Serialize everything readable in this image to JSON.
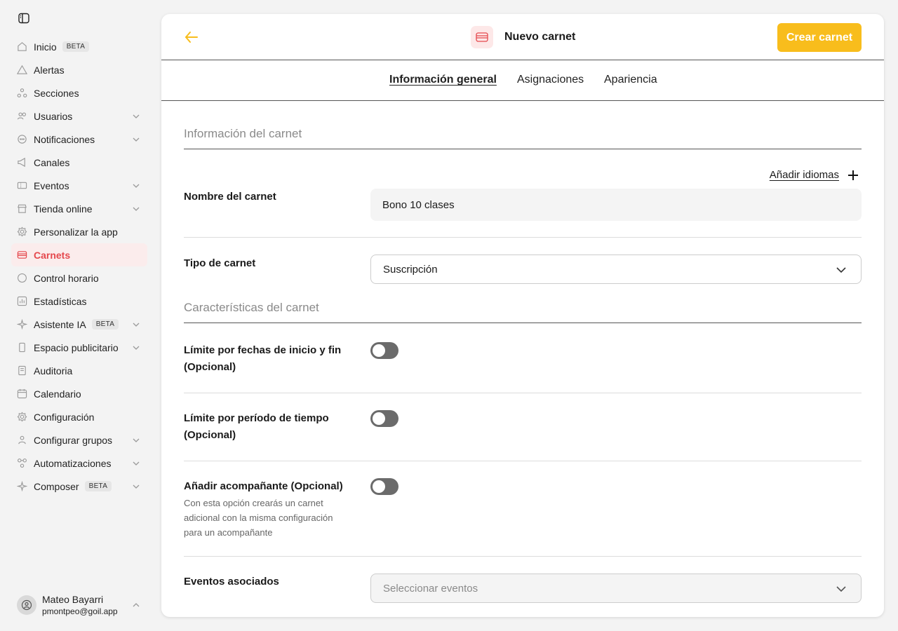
{
  "sidebar": {
    "items": [
      {
        "label": "Inicio",
        "beta": "BETA",
        "icon": "home-icon"
      },
      {
        "label": "Alertas",
        "icon": "alert-icon"
      },
      {
        "label": "Secciones",
        "icon": "sections-icon"
      },
      {
        "label": "Usuarios",
        "icon": "users-icon"
      },
      {
        "label": "Notificaciones",
        "icon": "chat-icon"
      },
      {
        "label": "Canales",
        "icon": "megaphone-icon"
      },
      {
        "label": "Eventos",
        "icon": "ticket-icon"
      },
      {
        "label": "Tienda online",
        "icon": "shop-icon"
      },
      {
        "label": "Personalizar la app",
        "icon": "gear-icon"
      },
      {
        "label": "Carnets",
        "icon": "card-icon"
      },
      {
        "label": "Control horario",
        "icon": "clock-icon"
      },
      {
        "label": "Estadísticas",
        "icon": "chart-icon"
      },
      {
        "label": "Asistente IA",
        "beta": "BETA",
        "icon": "sparkle-icon"
      },
      {
        "label": "Espacio publicitario",
        "icon": "phone-icon"
      },
      {
        "label": "Auditoria",
        "icon": "document-icon"
      },
      {
        "label": "Calendario",
        "icon": "calendar-icon"
      },
      {
        "label": "Configuración",
        "icon": "gear-icon"
      },
      {
        "label": "Configurar grupos",
        "icon": "group-icon"
      },
      {
        "label": "Automatizaciones",
        "icon": "automation-icon"
      },
      {
        "label": "Composer",
        "beta": "BETA",
        "icon": "sparkle-icon"
      }
    ],
    "active_color": "#e5484d"
  },
  "user": {
    "name": "Mateo Bayarri",
    "email": "pmontpeo@goil.app"
  },
  "header": {
    "title": "Nuevo carnet",
    "create_label": "Crear carnet",
    "accent": "#f8bd1c"
  },
  "tabs": [
    "Información general",
    "Asignaciones",
    "Apariencia"
  ],
  "form": {
    "section1": "Información del carnet",
    "add_languages": "Añadir idiomas",
    "name_label": "Nombre del carnet",
    "name_value": "Bono 10 clases",
    "type_label": "Tipo de carnet",
    "type_value": "Suscripción",
    "section2": "Características del carnet",
    "limit_dates_label": "Límite por fechas de inicio y fin (Opcional)",
    "limit_period_label": "Límite por período de tiempo (Opcional)",
    "companion_label": "Añadir acompañante (Opcional)",
    "companion_desc": "Con esta opción crearás un carnet adicional con la misma configuración para un acompañante",
    "events_label": "Eventos asociados",
    "events_placeholder": "Seleccionar eventos"
  }
}
